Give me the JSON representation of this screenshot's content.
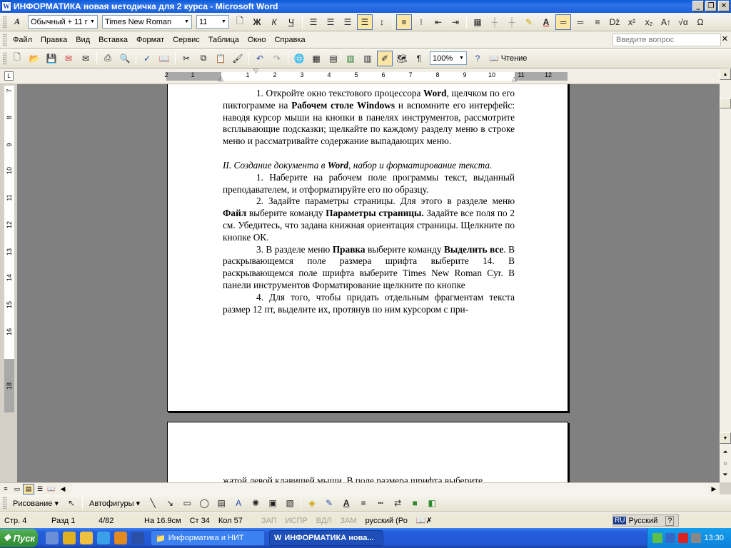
{
  "window": {
    "title": "ИНФОРМАТИКА новая методичка для 2 курса - Microsoft Word"
  },
  "format_toolbar": {
    "style": "Обычный + 11 г",
    "font": "Times New Roman",
    "size": "11"
  },
  "menu": {
    "items": [
      "Файл",
      "Правка",
      "Вид",
      "Вставка",
      "Формат",
      "Сервис",
      "Таблица",
      "Окно",
      "Справка"
    ],
    "ask_placeholder": "Введите вопрос"
  },
  "standard_toolbar": {
    "zoom": "100%",
    "reading": "Чтение"
  },
  "ruler": {
    "h_numbers": [
      "2",
      "1",
      "1",
      "2",
      "3",
      "4",
      "5",
      "6",
      "7",
      "8",
      "9",
      "10",
      "11",
      "12"
    ],
    "v_numbers": [
      "7",
      "8",
      "9",
      "10",
      "11",
      "12",
      "13",
      "14",
      "15",
      "16",
      "18"
    ]
  },
  "document": {
    "paragraphs": [
      {
        "id": "p1",
        "indent": true,
        "html": "1. Откройте окно текстового процессора <b>Word</b>, щелчком по его пиктограмме на <b>Рабочем столе Windows</b> и вспомните его интерфейс: наводя курсор мыши на кнопки в панелях инструментов, рассмотрите всплывающие подсказки; щелкайте по каждому разделу меню в строке меню и рассматривайте содержание выпадающих меню."
      },
      {
        "id": "p2",
        "indent": false,
        "html": "<em>II. Создание документа в <b>Word</b>, набор и форматирование текста.</em>"
      },
      {
        "id": "p3",
        "indent": true,
        "html": "1. Наберите на рабочем поле программы текст, выданный преподавателем, и отформатируйте его по образцу."
      },
      {
        "id": "p4",
        "indent": true,
        "html": "2. Задайте параметры страницы. Для этого в разделе меню <b>Файл</b> выберите команду <b>Параметры страницы.</b> Задайте все поля по 2 см. Убедитесь, что задана книжная ориентация страницы. Щелкните по кнопке ОК."
      },
      {
        "id": "p5",
        "indent": true,
        "html": "3. В разделе меню <b>Правка</b> выберите команду <b>Выделить все</b>. В раскрывающемся поле размера шрифта выберите 14. В раскрывающемся поле шрифта выберите Times New Roman Cyr. В панели инструментов Форматирование щелкните по кнопке"
      },
      {
        "id": "p6",
        "indent": true,
        "html": "4. Для того, чтобы придать отдельным фрагментам текста размер 12 пт, выделите их, протянув по ним курсором с при-"
      }
    ],
    "next_page_fragment": "жатой левой клавишей мыши. В поле размера шрифта выберите"
  },
  "drawing_toolbar": {
    "draw_label": "Рисование",
    "autoshapes_label": "Автофигуры"
  },
  "status": {
    "page": "Стр. 4",
    "section": "Разд 1",
    "pages": "4/82",
    "at": "На 16.9см",
    "line": "Ст 34",
    "col": "Кол 57",
    "rec": "ЗАП",
    "trk": "ИСПР",
    "ext": "ВДЛ",
    "ovr": "ЗАМ",
    "language": "русский (Ро"
  },
  "taskbar": {
    "start": "Пуск",
    "tasks": [
      "Информатика и НИТ",
      "ИНФОРМАТИКА нова..."
    ],
    "lang": "Русский",
    "ru": "RU",
    "clock": "13:30"
  },
  "colors": {
    "title_bar": "#2f72e8",
    "desktop_gray": "#808080",
    "active_button": "#fbe6a5"
  }
}
